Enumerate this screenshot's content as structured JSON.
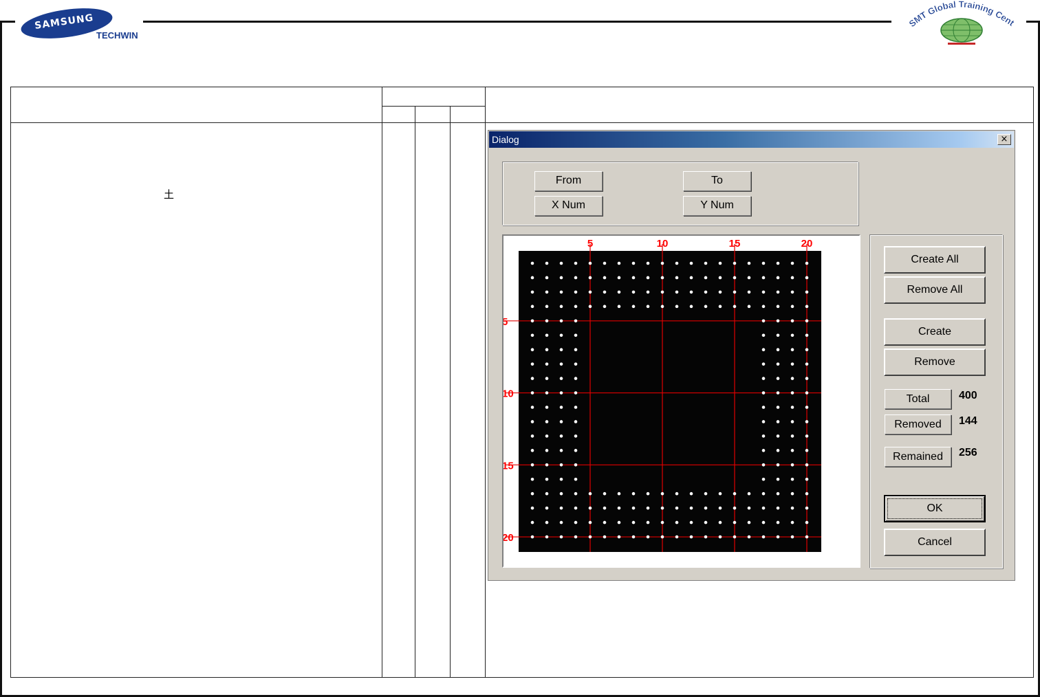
{
  "header": {
    "brand": "SAMSUNG",
    "brand_sub": "TECHWIN",
    "partner_logo_text": "SMT Global Training Center"
  },
  "side_note": {
    "symbol": "土"
  },
  "dialog": {
    "title": "Dialog",
    "close_label": "×",
    "range_fields": {
      "from_label": "From",
      "to_label": "To",
      "xnum_label": "X Num",
      "ynum_label": "Y Num"
    },
    "buttons": {
      "create_all": "Create All",
      "remove_all": "Remove All",
      "create": "Create",
      "remove": "Remove",
      "ok": "OK",
      "cancel": "Cancel"
    },
    "stats": {
      "total_label": "Total",
      "total_value": "400",
      "removed_label": "Removed",
      "removed_value": "144",
      "remained_label": "Remained",
      "remained_value": "256"
    },
    "grid": {
      "columns": 20,
      "rows": 20,
      "border_width": 4,
      "tick_labels": [
        "5",
        "10",
        "15",
        "20"
      ],
      "colors": {
        "background": "#050505",
        "guide_line": "#e00000",
        "tick_label": "#ff0000",
        "ball": "#ffffff"
      }
    }
  }
}
